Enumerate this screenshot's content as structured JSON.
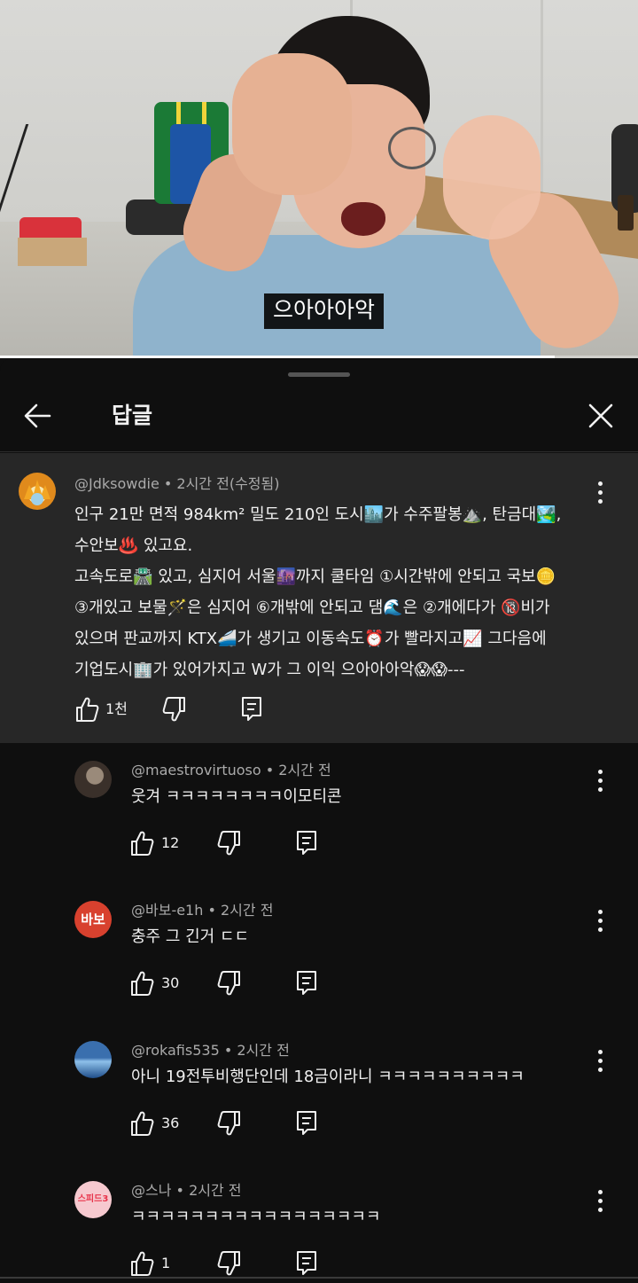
{
  "video": {
    "caption": "으아아아악",
    "progress_fraction": 0.87
  },
  "sheet": {
    "title": "답글",
    "back_icon": "arrow-left-icon",
    "close_icon": "close-icon"
  },
  "parent_comment": {
    "handle": "@Jdksowdie",
    "meta": " • 2시간 전(수정됨)",
    "lines": [
      "인구 21만 면적 984km² 밀도 210인 도시🏙️가 수주팔봉⛰️, 탄금대🏞️,",
      "수안보♨️ 있고요.",
      "고속도로🛣️ 있고, 심지어 서울🌆까지 쿨타임 ①시간밖에 안되고 국보🪙",
      "③개있고 보물🪄은 심지어 ⑥개밖에 안되고 댐🌊은 ②개에다가 🔞비가",
      "있으며 판교까지 KTX🚄가 생기고 이동속도⏰가 빨라지고📈 그다음에",
      "기업도시🏢가 있어가지고 W가 그 이익 으아아아악😱😱---"
    ],
    "likes": "1천"
  },
  "replies": [
    {
      "handle": "@maestrovirtuoso",
      "meta": " • 2시간 전",
      "text": "웃겨 ㅋㅋㅋㅋㅋㅋㅋㅋ이모티콘",
      "likes": "12",
      "avatar_label": "",
      "avatar_color": "#4a4038"
    },
    {
      "handle": "@바보-e1h",
      "meta": " • 2시간 전",
      "text": "충주 그 긴거 ㄷㄷ",
      "likes": "30",
      "avatar_label": "바보",
      "avatar_color": "#d8412e"
    },
    {
      "handle": "@rokafis535",
      "meta": " • 2시간 전",
      "text": "아니 19전투비행단인데 18금이라니 ㅋㅋㅋㅋㅋㅋㅋㅋㅋㅋ",
      "likes": "36",
      "avatar_label": "",
      "avatar_color": "#3d78b8"
    },
    {
      "handle": "@스나",
      "meta": " • 2시간 전",
      "text": "ㅋㅋㅋㅋㅋㅋㅋㅋㅋㅋㅋㅋㅋㅋㅋㅋㅋ",
      "likes": "1",
      "avatar_label": "스피드3",
      "avatar_color": "#f6c9cf"
    }
  ],
  "icons": {
    "like": "thumb-up-icon",
    "dislike": "thumb-down-icon",
    "reply": "reply-icon",
    "more": "more-vert-icon"
  }
}
